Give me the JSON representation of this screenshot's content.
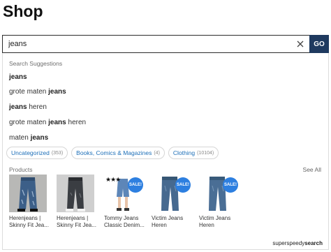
{
  "page": {
    "title": "Shop"
  },
  "search": {
    "value": "jeans",
    "go_label": "GO",
    "clear_icon": "close-icon"
  },
  "suggestions": {
    "heading": "Search Suggestions",
    "items": [
      {
        "before": "",
        "bold": "jeans",
        "after": ""
      },
      {
        "before": "grote maten ",
        "bold": "jeans",
        "after": ""
      },
      {
        "before": "",
        "bold": "jeans",
        "after": " heren"
      },
      {
        "before": "grote maten ",
        "bold": "jeans",
        "after": " heren"
      },
      {
        "before": "maten ",
        "bold": "jeans",
        "after": ""
      }
    ]
  },
  "categories": [
    {
      "label": "Uncategorized",
      "count": "(353)"
    },
    {
      "label": "Books, Comics & Magazines",
      "count": "(4)"
    },
    {
      "label": "Clothing",
      "count": "(10104)"
    }
  ],
  "products": {
    "heading": "Products",
    "see_all_label": "See All",
    "items": [
      {
        "name_line1": "Herenjeans |",
        "name_line2": "Skinny Fit Jea...",
        "sale": "",
        "stars": ""
      },
      {
        "name_line1": "Herenjeans |",
        "name_line2": "Skinny Fit Jea...",
        "sale": "",
        "stars": ""
      },
      {
        "name_line1": "Tommy Jeans",
        "name_line2": "Classic Denim...",
        "sale": "SALE!",
        "stars": "★★★"
      },
      {
        "name_line1": "Victim Jeans",
        "name_line2": "Heren",
        "sale": "SALE!",
        "stars": ""
      },
      {
        "name_line1": "Victim Jeans",
        "name_line2": "Heren",
        "sale": "SALE!",
        "stars": ""
      }
    ]
  },
  "footer": {
    "powered_prefix": "superspeedy",
    "powered_bold": "search"
  },
  "colors": {
    "accent": "#1f3a5f",
    "link": "#1d6fb8",
    "sale": "#2d7fe0"
  }
}
